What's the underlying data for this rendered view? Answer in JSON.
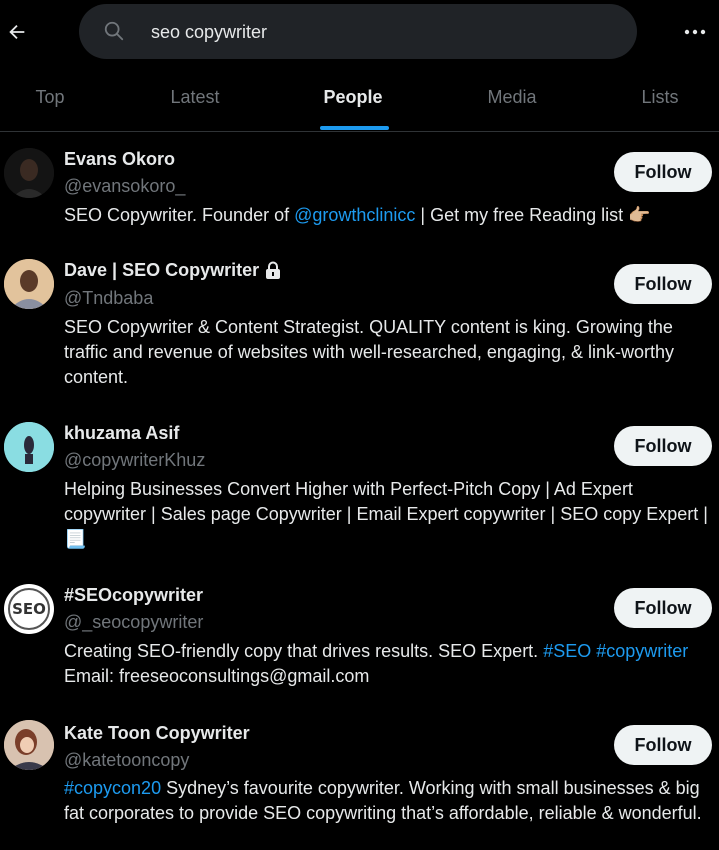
{
  "search": {
    "value": "seo copywriter"
  },
  "tabs": [
    {
      "label": "Top"
    },
    {
      "label": "Latest"
    },
    {
      "label": "People"
    },
    {
      "label": "Media"
    },
    {
      "label": "Lists"
    }
  ],
  "active_tab": "People",
  "follow_label": "Follow",
  "users": [
    {
      "name": "Evans Okoro",
      "handle": "@evansokoro_",
      "bio": {
        "p1": "SEO Copywriter. Founder of ",
        "link1": "@growthclinicc",
        "p2": " | Get my free Reading list 👉🏼"
      }
    },
    {
      "name": "Dave | SEO Copywriter",
      "handle": "@Tndbaba",
      "bio": {
        "p1": "SEO Copywriter & Content Strategist. QUALITY content is king. Growing the traffic and revenue of websites with well-researched, engaging, & link-worthy content."
      }
    },
    {
      "name": "khuzama Asif",
      "handle": "@copywriterKhuz",
      "bio": {
        "p1": "Helping Businesses Convert Higher with Perfect-Pitch Copy | Ad Expert copywriter | Sales page Copywriter | Email Expert copywriter | SEO copy Expert |📃"
      }
    },
    {
      "name": "#SEOcopywriter",
      "handle": "@_seocopywriter",
      "avatar_text": "SEO",
      "bio": {
        "p1": "Creating SEO-friendly copy that drives results. SEO Expert. ",
        "link1": "#SEO",
        "p2": " ",
        "link2": "#copywriter",
        "p3": " Email: freeseoconsultings@gmail.com"
      }
    },
    {
      "name": "Kate Toon Copywriter",
      "handle": "@katetooncopy",
      "bio": {
        "link1": "#copycon20",
        "p1": " Sydney’s favourite copywriter. Working with small businesses & big fat corporates to provide SEO copywriting that’s affordable, reliable & wonderful."
      }
    }
  ]
}
